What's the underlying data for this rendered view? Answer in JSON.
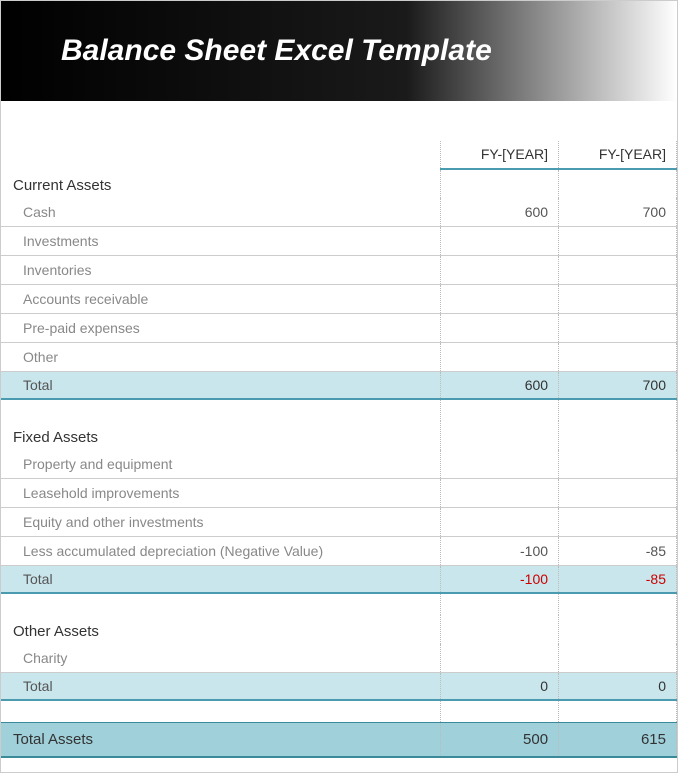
{
  "header": {
    "title": "Balance Sheet Excel Template"
  },
  "columns": {
    "year1": "FY-[YEAR]",
    "year2": "FY-[YEAR]"
  },
  "sections": {
    "current_assets": {
      "title": "Current Assets",
      "rows": {
        "cash": {
          "label": "Cash",
          "y1": "600",
          "y2": "700"
        },
        "investments": {
          "label": "Investments",
          "y1": "",
          "y2": ""
        },
        "inventories": {
          "label": "Inventories",
          "y1": "",
          "y2": ""
        },
        "accounts_receivable": {
          "label": "Accounts receivable",
          "y1": "",
          "y2": ""
        },
        "prepaid": {
          "label": "Pre-paid expenses",
          "y1": "",
          "y2": ""
        },
        "other": {
          "label": "Other",
          "y1": "",
          "y2": ""
        }
      },
      "total": {
        "label": "Total",
        "y1": "600",
        "y2": "700"
      }
    },
    "fixed_assets": {
      "title": "Fixed Assets",
      "rows": {
        "property": {
          "label": "Property and equipment",
          "y1": "",
          "y2": ""
        },
        "leasehold": {
          "label": "Leasehold improvements",
          "y1": "",
          "y2": ""
        },
        "equity": {
          "label": "Equity and other investments",
          "y1": "",
          "y2": ""
        },
        "depreciation": {
          "label": "Less accumulated depreciation (Negative Value)",
          "y1": "-100",
          "y2": "-85"
        }
      },
      "total": {
        "label": "Total",
        "y1": "-100",
        "y2": "-85"
      }
    },
    "other_assets": {
      "title": "Other Assets",
      "rows": {
        "charity": {
          "label": "Charity",
          "y1": "",
          "y2": ""
        }
      },
      "total": {
        "label": "Total",
        "y1": "0",
        "y2": "0"
      }
    }
  },
  "grand_total": {
    "label": "Total Assets",
    "y1": "500",
    "y2": "615"
  }
}
